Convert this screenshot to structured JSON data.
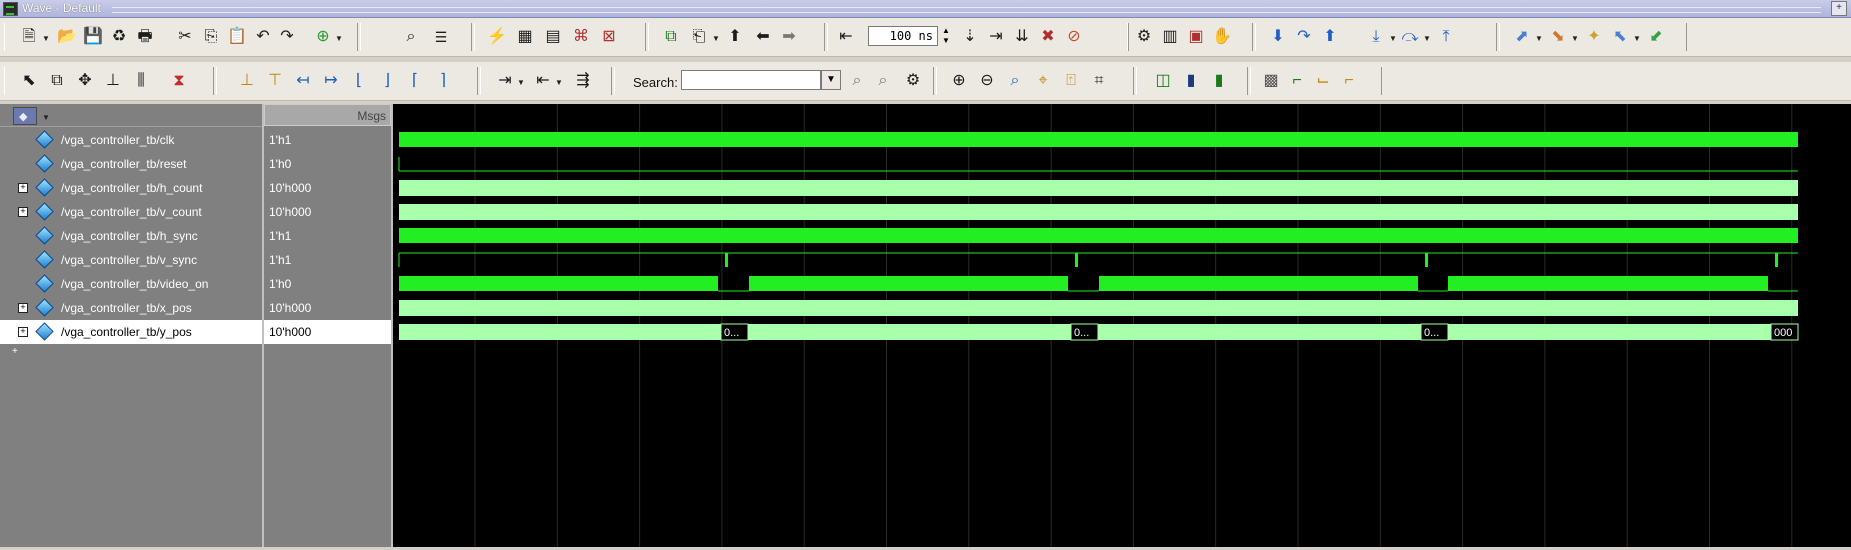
{
  "window": {
    "title": "Wave - Default"
  },
  "toolbar": {
    "time_value": "100 ns",
    "search_label": "Search:",
    "search_value": ""
  },
  "panels": {
    "values_header": "Msgs"
  },
  "signals": [
    {
      "name": "/vga_controller_tb/clk",
      "value": "1'h1",
      "expandable": false,
      "selected": false
    },
    {
      "name": "/vga_controller_tb/reset",
      "value": "1'h0",
      "expandable": false,
      "selected": false
    },
    {
      "name": "/vga_controller_tb/h_count",
      "value": "10'h000",
      "expandable": true,
      "selected": false
    },
    {
      "name": "/vga_controller_tb/v_count",
      "value": "10'h000",
      "expandable": true,
      "selected": false
    },
    {
      "name": "/vga_controller_tb/h_sync",
      "value": "1'h1",
      "expandable": false,
      "selected": false
    },
    {
      "name": "/vga_controller_tb/v_sync",
      "value": "1'h1",
      "expandable": false,
      "selected": false
    },
    {
      "name": "/vga_controller_tb/video_on",
      "value": "1'h0",
      "expandable": false,
      "selected": false
    },
    {
      "name": "/vga_controller_tb/x_pos",
      "value": "10'h000",
      "expandable": true,
      "selected": false
    },
    {
      "name": "/vga_controller_tb/y_pos",
      "value": "10'h000",
      "expandable": true,
      "selected": true
    }
  ],
  "y_pos_labels": [
    "0...",
    "0...",
    "0...",
    "000"
  ],
  "colors": {
    "wave_bright": "#22ee22",
    "wave_bus": "#aaffaa",
    "background": "#000000",
    "grid": "#2a2a2a"
  }
}
